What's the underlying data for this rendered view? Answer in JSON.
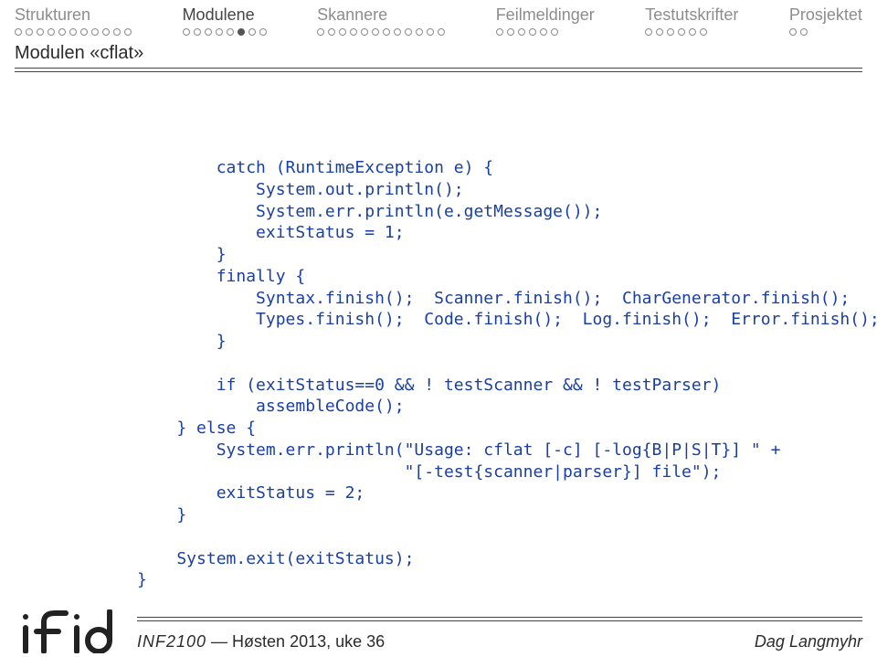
{
  "nav": {
    "items": [
      {
        "label": "Strukturen",
        "total": 11,
        "current": 0
      },
      {
        "label": "Modulene",
        "total": 8,
        "current": 6,
        "active": true
      },
      {
        "label": "Skannere",
        "total": 12,
        "current": 0
      },
      {
        "label": "Feilmeldinger",
        "total": 6,
        "current": 0
      },
      {
        "label": "Testutskrifter",
        "total": 6,
        "current": 0
      },
      {
        "label": "Prosjektet",
        "total": 2,
        "current": 0
      }
    ]
  },
  "subtitle": "Modulen «cflat»",
  "code": "        catch (RuntimeException e) {\n            System.out.println();\n            System.err.println(e.getMessage());\n            exitStatus = 1;\n        }\n        finally {\n            Syntax.finish();  Scanner.finish();  CharGenerator.finish();\n            Types.finish();  Code.finish();  Log.finish();  Error.finish();\n        }\n\n        if (exitStatus==0 && ! testScanner && ! testParser)\n            assembleCode();\n    } else {\n        System.err.println(\"Usage: cflat [-c] [-log{B|P|S|T}] \" +\n                           \"[-test{scanner|parser}] file\");\n        exitStatus = 2;\n    }\n\n    System.exit(exitStatus);\n}",
  "footer": {
    "course": "INF2100",
    "rest": " — Høsten 2013, uke 36",
    "author": "Dag Langmyhr"
  }
}
